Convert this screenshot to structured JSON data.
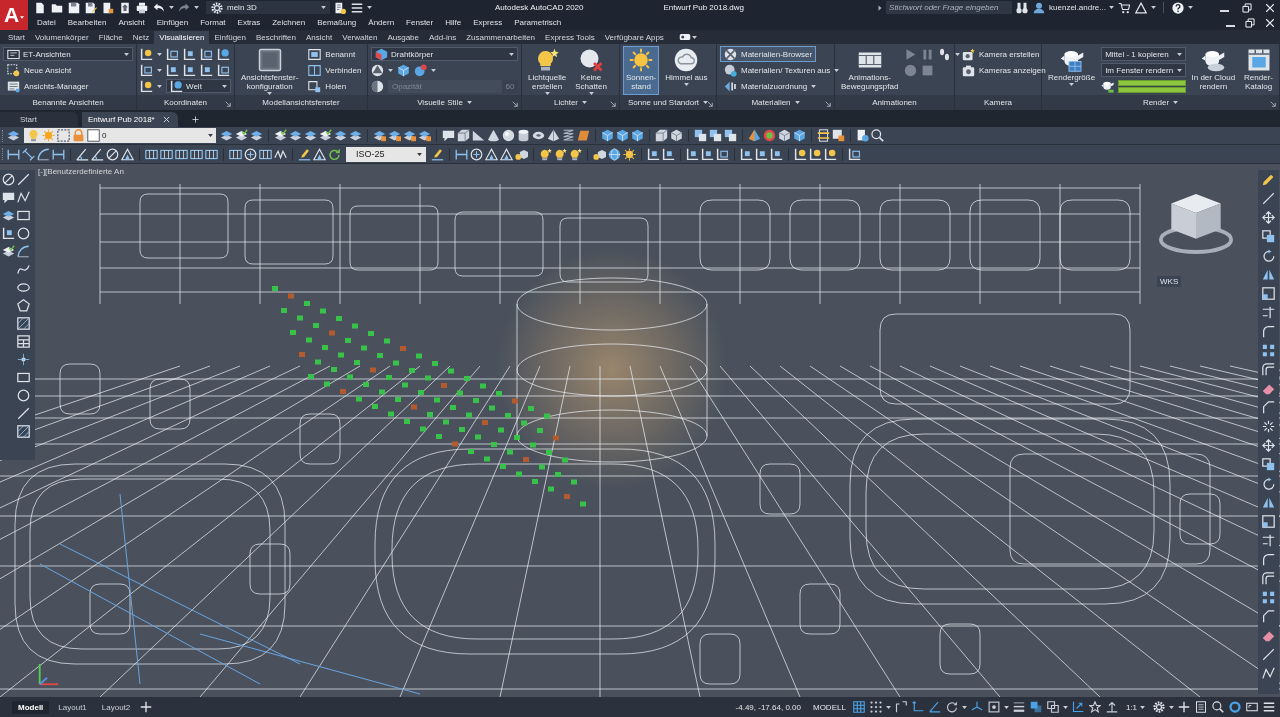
{
  "title_bar": {
    "app_menu": "A",
    "workspace": "mein 3D",
    "app_title": "Autodesk AutoCAD 2020",
    "file_name": "Entwurf Pub 2018.dwg",
    "search": {
      "placeholder": "Stichwort oder Frage eingeben"
    },
    "user": "kuenzel.andre..."
  },
  "menu_bar": [
    "Datei",
    "Bearbeiten",
    "Ansicht",
    "Einfügen",
    "Format",
    "Extras",
    "Zeichnen",
    "Bemaßung",
    "Ändern",
    "Fenster",
    "Hilfe",
    "Express",
    "Parametrisch"
  ],
  "ribbon": {
    "tabs": [
      {
        "label": "Start",
        "selected": false
      },
      {
        "label": "Volumenkörper",
        "selected": false
      },
      {
        "label": "Fläche",
        "selected": false
      },
      {
        "label": "Netz",
        "selected": false
      },
      {
        "label": "Visualisieren",
        "selected": true
      },
      {
        "label": "Einfügen",
        "selected": false
      },
      {
        "label": "Beschriften",
        "selected": false
      },
      {
        "label": "Ansicht",
        "selected": false
      },
      {
        "label": "Verwalten",
        "selected": false
      },
      {
        "label": "Ausgabe",
        "selected": false
      },
      {
        "label": "Add-ins",
        "selected": false
      },
      {
        "label": "Zusammenarbeiten",
        "selected": false
      },
      {
        "label": "Express Tools",
        "selected": false
      },
      {
        "label": "Verfügbare Apps",
        "selected": false
      }
    ],
    "panels": [
      {
        "title": "Benannte Ansichten",
        "menu": false,
        "launcher": false,
        "columns": [
          [
            {
              "kind": "dropdown",
              "value": "ET-Ansichten"
            },
            {
              "kind": "button",
              "label": "Neue Ansicht",
              "caret": false,
              "on": false
            },
            {
              "kind": "button",
              "label": "Ansichts-Manager",
              "caret": false,
              "on": false
            }
          ]
        ]
      },
      {
        "title": "Koordinaten",
        "menu": false,
        "launcher": true,
        "columns": [
          [
            {
              "kind": "tools"
            },
            {
              "kind": "tools"
            },
            {
              "kind": "tool-dropdown",
              "value": "Welt"
            }
          ]
        ]
      },
      {
        "title": "Modellansichtsfenster",
        "menu": false,
        "launcher": false,
        "columns": [
          [
            {
              "kind": "large",
              "label": "Ansichtsfenster-\nkonfiguration",
              "caret": true,
              "on": false
            }
          ],
          [
            {
              "kind": "button",
              "label": "Benannt",
              "caret": false,
              "on": false
            },
            {
              "kind": "button",
              "label": "Verbinden",
              "caret": false,
              "on": false
            },
            {
              "kind": "button",
              "label": "Holen",
              "caret": false,
              "on": false
            }
          ]
        ]
      },
      {
        "title": "Visuelle Stile",
        "menu": true,
        "launcher": true,
        "columns": [
          [
            {
              "kind": "dropdown",
              "value": "Drahtkörper"
            },
            {
              "kind": "tools"
            },
            {
              "kind": "slider",
              "label": "Opazität",
              "reading": "60",
              "disabled": true
            }
          ]
        ]
      },
      {
        "title": "Lichter",
        "menu": true,
        "launcher": true,
        "columns": [
          [
            {
              "kind": "large",
              "label": "Lichtquelle\nerstellen",
              "caret": true,
              "on": false
            }
          ],
          [
            {
              "kind": "large",
              "label": "Keine\nSchatten",
              "caret": true,
              "on": false
            }
          ]
        ]
      },
      {
        "title": "Sonne und Standort",
        "menu": true,
        "launcher": true,
        "columns": [
          [
            {
              "kind": "large",
              "label": "Sonnen-\nstand",
              "caret": false,
              "on": true
            }
          ],
          [
            {
              "kind": "large",
              "label": "Himmel aus",
              "caret": true,
              "on": false
            }
          ]
        ]
      },
      {
        "title": "Materialien",
        "menu": true,
        "launcher": true,
        "columns": [
          [
            {
              "kind": "button",
              "label": "Materialien-Browser",
              "caret": false,
              "on": true
            },
            {
              "kind": "button",
              "label": "Materialien/ Texturen aus",
              "caret": true,
              "on": false
            },
            {
              "kind": "button",
              "label": "Materialzuordnung",
              "caret": true,
              "on": false
            }
          ]
        ]
      },
      {
        "title": "Animationen",
        "menu": false,
        "launcher": false,
        "columns": [
          [
            {
              "kind": "large",
              "label": "Animations-\nBewegungspfad",
              "caret": false,
              "on": false
            }
          ],
          [
            {
              "kind": "tools"
            },
            {
              "kind": "tools"
            }
          ]
        ]
      },
      {
        "title": "Kamera",
        "menu": false,
        "launcher": false,
        "columns": [
          [
            {
              "kind": "button",
              "label": "Kamera erstellen",
              "caret": false,
              "on": false
            },
            {
              "kind": "button",
              "label": "Kameras anzeigen",
              "caret": false,
              "on": false
            }
          ]
        ]
      },
      {
        "title": "Render",
        "menu": true,
        "launcher": true,
        "columns": [
          [
            {
              "kind": "large",
              "label": "Rendergröße",
              "caret": true,
              "on": false
            }
          ],
          [
            {
              "kind": "dropdown",
              "value": "Mittel - 1 kopieren"
            },
            {
              "kind": "dropdown",
              "value": "Im Fenster rendern"
            },
            {
              "kind": "progress",
              "bars": [
                {
                  "level": 1
                },
                {
                  "level": 1
                }
              ]
            }
          ],
          [
            {
              "kind": "large",
              "label": "In der Cloud\nrendern",
              "caret": false,
              "on": false
            }
          ],
          [
            {
              "kind": "large",
              "label": "Render-\nKatalog",
              "caret": false,
              "on": false
            }
          ]
        ]
      }
    ]
  },
  "document_tabs": [
    {
      "label": "Start",
      "selected": false,
      "closable": false
    },
    {
      "label": "Entwurf Pub 2018*",
      "selected": true,
      "closable": true
    }
  ],
  "layer_toolbar": {
    "layer": "0"
  },
  "dimension_toolbar": {
    "style": "ISO-25"
  },
  "viewport": {
    "label": "[-][Benutzerdefinierte An",
    "ucs_menu": "WKS"
  },
  "status_bar": {
    "layouts": [
      {
        "label": "Modell",
        "selected": true
      },
      {
        "label": "Layout1",
        "selected": false
      },
      {
        "label": "Layout2",
        "selected": false
      }
    ],
    "coordinates": "-4.49, -17.64, 0.00",
    "space": "MODELL",
    "toggles": [
      {
        "on": true
      },
      {
        "on": false
      },
      {
        "on": false
      },
      {
        "on": true
      },
      {
        "on": true
      },
      {
        "on": false
      },
      {
        "on": true
      },
      {
        "on": false
      },
      {
        "on": false
      },
      {
        "on": true
      },
      {
        "on": false
      },
      {
        "on": true
      },
      {
        "on": false
      },
      {
        "on": false
      }
    ],
    "annotation_scale": "1:1",
    "hardware_acceleration": {
      "on": true
    }
  }
}
